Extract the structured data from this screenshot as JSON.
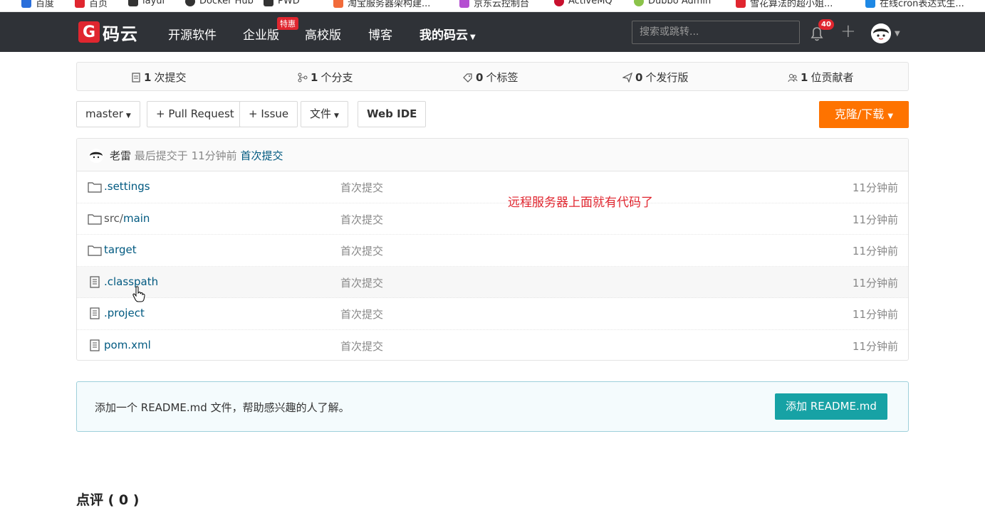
{
  "bookmarks": [
    "百度",
    "百页",
    "layui",
    "Docker Hub",
    "PWD",
    "淘宝服务器架构建...",
    "京东云控制台",
    "ActiveMQ",
    "Dubbo Admin",
    "雪花算法的超小姐...",
    "在线cron表达式生..."
  ],
  "nav": {
    "logo_text": "码云",
    "items": [
      "开源软件",
      "企业版",
      "高校版",
      "博客",
      "我的码云"
    ],
    "badge": "特惠",
    "search_placeholder": "搜索或跳转...",
    "notification_count": "40"
  },
  "stats": [
    {
      "count": "1",
      "label": "次提交"
    },
    {
      "count": "1",
      "label": "个分支"
    },
    {
      "count": "0",
      "label": "个标签"
    },
    {
      "count": "0",
      "label": "个发行版"
    },
    {
      "count": "1",
      "label": "位贡献者"
    }
  ],
  "toolbar": {
    "branch": "master",
    "pull_request": "+ Pull Request",
    "issue": "+ Issue",
    "files": "文件",
    "web_ide": "Web IDE",
    "clone": "克隆/下载"
  },
  "commit": {
    "author": "老雷",
    "meta": "最后提交于 11分钟前",
    "message": "首次提交"
  },
  "files": [
    {
      "type": "folder",
      "name": ".settings",
      "name_prefix": "",
      "commit": "首次提交",
      "time": "11分钟前"
    },
    {
      "type": "folder",
      "name": "main",
      "name_prefix": "src/",
      "commit": "首次提交",
      "time": "11分钟前"
    },
    {
      "type": "folder",
      "name": "target",
      "name_prefix": "",
      "commit": "首次提交",
      "time": "11分钟前"
    },
    {
      "type": "file",
      "name": ".classpath",
      "name_prefix": "",
      "commit": "首次提交",
      "time": "11分钟前"
    },
    {
      "type": "file",
      "name": ".project",
      "name_prefix": "",
      "commit": "首次提交",
      "time": "11分钟前"
    },
    {
      "type": "file",
      "name": "pom.xml",
      "name_prefix": "",
      "commit": "首次提交",
      "time": "11分钟前"
    }
  ],
  "annotation": "远程服务器上面就有代码了",
  "readme": {
    "tip": "添加一个 README.md 文件，帮助感兴趣的人了解。",
    "button": "添加 README.md"
  },
  "comments_title": "点评 ( 0 )",
  "colors": {
    "navbar": "#2f3237",
    "brand_red": "#e0262f",
    "clone_orange": "#fe7300",
    "readme_teal": "#17a2a5",
    "link_blue": "#005980"
  }
}
